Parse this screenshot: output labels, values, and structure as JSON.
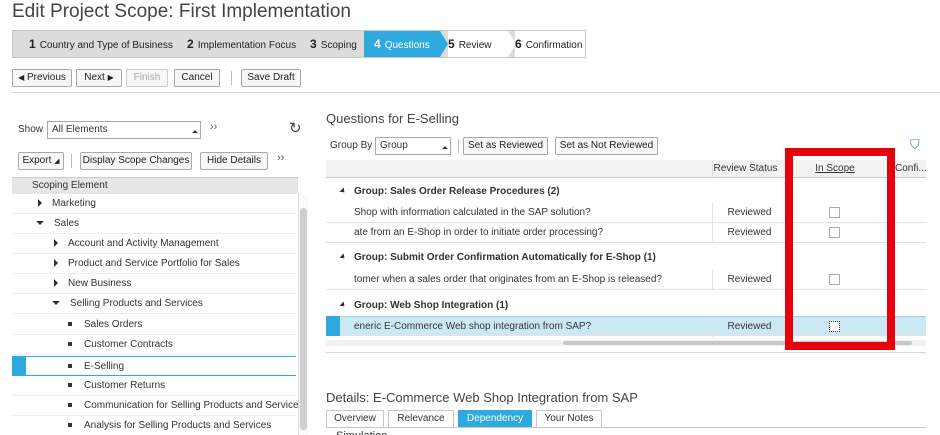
{
  "page": {
    "title": "Edit Project Scope: First Implementation"
  },
  "wizard": {
    "steps": [
      {
        "num": "1",
        "label": "Country and Type of Business"
      },
      {
        "num": "2",
        "label": "Implementation Focus"
      },
      {
        "num": "3",
        "label": "Scoping"
      },
      {
        "num": "4",
        "label": "Questions"
      },
      {
        "num": "5",
        "label": "Review"
      },
      {
        "num": "6",
        "label": "Confirmation"
      }
    ],
    "active_step": "4"
  },
  "toolbar": {
    "previous": "Previous",
    "next": "Next",
    "finish": "Finish",
    "cancel": "Cancel",
    "save_draft": "Save Draft"
  },
  "left": {
    "show_label": "Show",
    "show_value": "All Elements",
    "more": "››",
    "export": "Export",
    "display_scope_changes": "Display Scope Changes",
    "hide_details": "Hide Details",
    "tree_header": "Scoping Element",
    "tree_items": [
      {
        "label": "Marketing",
        "marker": "collapsed"
      },
      {
        "label": "Sales",
        "marker": "expanded"
      },
      {
        "label": "Account and Activity Management",
        "marker": "collapsed"
      },
      {
        "label": "Product and Service Portfolio for Sales",
        "marker": "collapsed"
      },
      {
        "label": "New Business",
        "marker": "collapsed"
      },
      {
        "label": "Selling Products and Services",
        "marker": "expanded"
      },
      {
        "label": "Sales Orders",
        "marker": "leaf"
      },
      {
        "label": "Customer Contracts",
        "marker": "leaf"
      },
      {
        "label": "E-Selling",
        "marker": "leaf"
      },
      {
        "label": "Customer Returns",
        "marker": "leaf"
      },
      {
        "label": "Communication for Selling Products and Services",
        "marker": "leaf"
      },
      {
        "label": "Analysis for Selling Products and Services",
        "marker": "leaf"
      }
    ]
  },
  "questions": {
    "title": "Questions for E-Selling",
    "group_by_label": "Group By",
    "group_by_value": "Group",
    "set_reviewed": "Set as Reviewed",
    "set_not_reviewed": "Set as Not Reviewed",
    "columns": {
      "review_status": "Review Status",
      "in_scope": "In Scope",
      "conf": "Confi..."
    },
    "groups": [
      {
        "title": "Group: Sales Order Release Procedures (2)",
        "rows": [
          {
            "text": "Shop with information calculated in the SAP solution?",
            "status": "Reviewed"
          },
          {
            "text": "ate from an E-Shop in order to initiate order processing?",
            "status": "Reviewed"
          }
        ]
      },
      {
        "title": "Group: Submit Order Confirmation Automatically for E-Shop (1)",
        "rows": [
          {
            "text": "tomer when a sales order that originates from an E-Shop is released?",
            "status": "Reviewed"
          }
        ]
      },
      {
        "title": "Group: Web Shop Integration (1)",
        "rows": [
          {
            "text": "eneric E-Commerce Web shop integration from SAP?",
            "status": "Reviewed"
          }
        ]
      }
    ]
  },
  "details": {
    "title": "Details: E-Commerce Web Shop Integration from SAP",
    "tabs": [
      "Overview",
      "Relevance",
      "Dependency",
      "Your Notes"
    ],
    "active_tab": "Dependency",
    "section": "Simulation"
  },
  "colors": {
    "accent": "#2eaae1",
    "highlight": "#e8000b",
    "selected_row": "#cde8f5"
  }
}
